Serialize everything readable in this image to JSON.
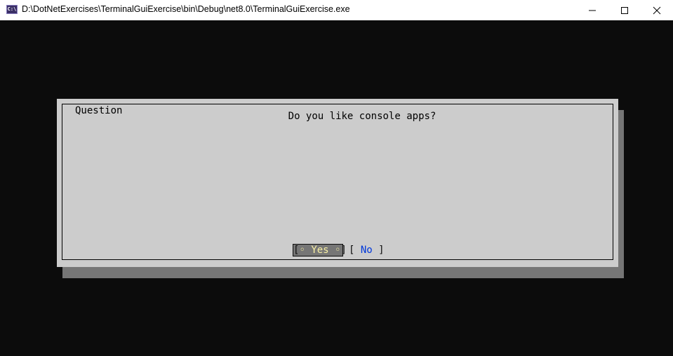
{
  "window": {
    "icon_text": "C:\\",
    "title": "D:\\DotNetExercises\\TerminalGuiExercise\\bin\\Debug\\net8.0\\TerminalGuiExercise.exe",
    "icons": [
      "app-icon",
      "minimize-icon",
      "maximize-icon",
      "close-icon"
    ]
  },
  "dialog": {
    "title": "Question",
    "message": "Do you like console apps?",
    "buttons": {
      "yes": {
        "open": "[",
        "marker_left": "◦",
        "label": "Yes",
        "marker_right": "◦",
        "close": "]"
      },
      "no": {
        "open": "[ ",
        "label": "No",
        "close": " ]"
      }
    }
  },
  "colors": {
    "console_bg": "#0c0c0c",
    "dialog_bg": "#cccccc",
    "shadow": "#767676",
    "focused_button_bg": "#767676",
    "focused_button_text": "#f9f1a5",
    "hotkey_blue": "#0037da"
  }
}
